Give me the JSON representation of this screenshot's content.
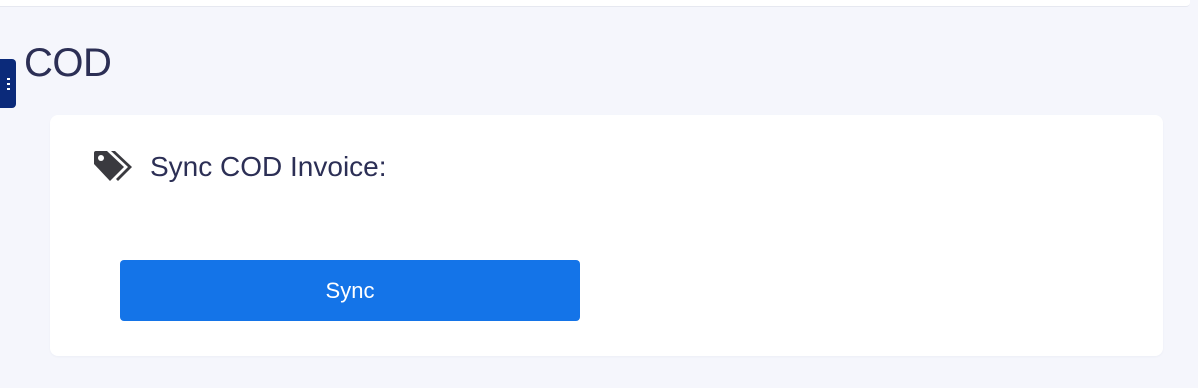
{
  "page": {
    "title": "COD"
  },
  "card": {
    "icon": "tags-icon",
    "title": "Sync COD Invoice:",
    "sync_button_label": "Sync"
  },
  "sidebar_toggle": {
    "icon": "menu-dots-icon"
  },
  "colors": {
    "accent": "#1474e8",
    "sidebar_toggle": "#0b2a7a",
    "text": "#2c2f55",
    "background": "#f5f6fc"
  }
}
